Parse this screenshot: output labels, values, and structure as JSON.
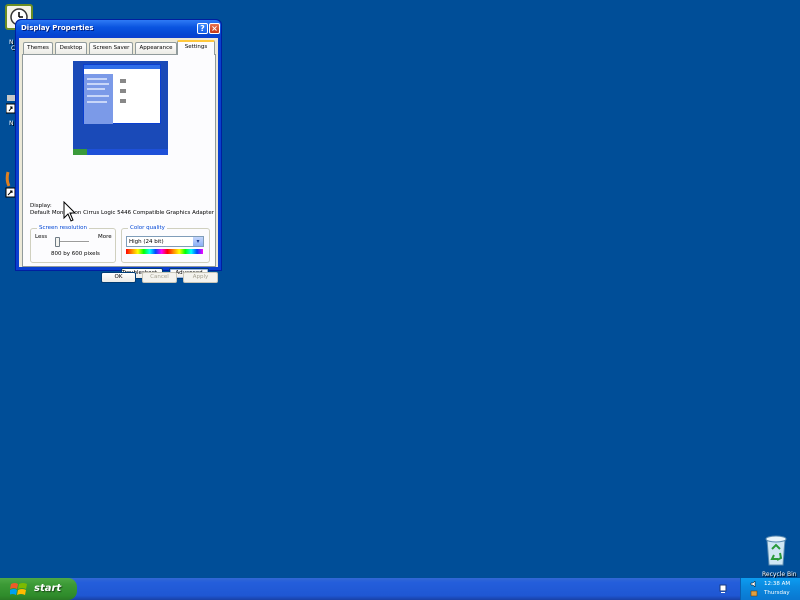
{
  "desktop": {
    "left_icon_labels": [
      "N",
      "C",
      "N"
    ],
    "recycle_bin_label": "Recycle Bin"
  },
  "window": {
    "title": "Display Properties",
    "help_glyph": "?",
    "close_glyph": "×",
    "tabs": [
      {
        "label": "Themes",
        "active": false
      },
      {
        "label": "Desktop",
        "active": false
      },
      {
        "label": "Screen Saver",
        "active": false
      },
      {
        "label": "Appearance",
        "active": false
      },
      {
        "label": "Settings",
        "active": true
      }
    ],
    "display_label": "Display:",
    "display_value": "Default Monitor on Cirrus Logic 5446 Compatible Graphics Adapter",
    "screen_resolution": {
      "title": "Screen resolution",
      "less_label": "Less",
      "more_label": "More",
      "value_text": "800 by 600 pixels",
      "slider_level_fraction": 0.0
    },
    "color_quality": {
      "title": "Color quality",
      "selected": "High (24 bit)"
    },
    "troubleshoot_label": "Troubleshoot...",
    "advanced_label": "Advanced",
    "ok_label": "OK",
    "cancel_label": "Cancel",
    "apply_label": "Apply"
  },
  "taskbar": {
    "start_label": "start",
    "time": "12:38 AM",
    "day": "Thursday"
  },
  "colors": {
    "desktop_bg": "#004e98",
    "taskbar_blue": "#245edb",
    "start_green": "#3c9a36",
    "xp_title_blue": "#0a55e0",
    "dialog_face": "#ece9d8",
    "tab_highlight": "#ffc83c",
    "tray_blue": "#0b8ae0"
  },
  "icons": [
    "clock-shortcut-icon",
    "shortcut-arrow-icon",
    "help-icon",
    "close-icon",
    "mouse-cursor-icon",
    "recycle-bin-icon",
    "windows-logo-icon",
    "tray-network-icon",
    "tray-volume-icon",
    "dropdown-arrow-icon"
  ]
}
